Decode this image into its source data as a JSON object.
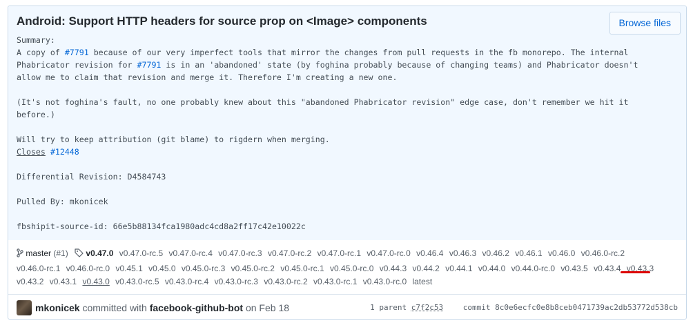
{
  "commit": {
    "title": "Android: Support HTTP headers for source prop on <Image> components",
    "browse_files_label": "Browse files",
    "description": [
      [
        {
          "t": "Summary:"
        }
      ],
      [
        {
          "t": "A copy of "
        },
        {
          "t": "#7791",
          "link": true
        },
        {
          "t": " because of our very imperfect tools that mirror the changes from pull requests in the fb monorepo. The internal"
        }
      ],
      [
        {
          "t": "Phabricator revision for "
        },
        {
          "t": "#7791",
          "link": true
        },
        {
          "t": " is in an 'abandoned' state (by foghina probably because of changing teams) and Phabricator doesn't"
        }
      ],
      [
        {
          "t": "allow me to claim that revision and merge it. Therefore I'm creating a new one."
        }
      ],
      [
        {
          "t": ""
        }
      ],
      [
        {
          "t": "(It's not foghina's fault, no one probably knew about this \"abandoned Phabricator revision\" edge case, don't remember we hit it"
        }
      ],
      [
        {
          "t": "before.)"
        }
      ],
      [
        {
          "t": ""
        }
      ],
      [
        {
          "t": "Will try to keep attribution (git blame) to rigdern when merging."
        }
      ],
      [
        {
          "t": "Closes",
          "underline": true
        },
        {
          "t": " "
        },
        {
          "t": "#12448",
          "link": true
        }
      ],
      [
        {
          "t": ""
        }
      ],
      [
        {
          "t": "Differential Revision: D4584743"
        }
      ],
      [
        {
          "t": ""
        }
      ],
      [
        {
          "t": "Pulled By: mkonicek"
        }
      ],
      [
        {
          "t": ""
        }
      ],
      [
        {
          "t": "fbshipit-source-id: 66e5b88134fca1980adc4cd8a2ff17c42e10022c"
        }
      ]
    ],
    "branch": {
      "name": "master",
      "pr": "(#1)"
    },
    "current_tag": "v0.47.0",
    "tags": [
      "v0.47.0-rc.5",
      "v0.47.0-rc.4",
      "v0.47.0-rc.3",
      "v0.47.0-rc.2",
      "v0.47.0-rc.1",
      "v0.47.0-rc.0",
      "v0.46.4",
      "v0.46.3",
      "v0.46.2",
      "v0.46.1",
      "v0.46.0",
      "v0.46.0-rc.2",
      "v0.46.0-rc.1",
      "v0.46.0-rc.0",
      "v0.45.1",
      "v0.45.0",
      "v0.45.0-rc.3",
      "v0.45.0-rc.2",
      "v0.45.0-rc.1",
      "v0.45.0-rc.0",
      "v0.44.3",
      "v0.44.2",
      "v0.44.1",
      "v0.44.0",
      "v0.44.0-rc.0",
      "v0.43.5",
      "v0.43.4",
      "v0.43.3",
      "v0.43.2",
      "v0.43.1",
      "v0.43.0",
      "v0.43.0-rc.5",
      "v0.43.0-rc.4",
      "v0.43.0-rc.3",
      "v0.43.0-rc.2",
      "v0.43.0-rc.1",
      "v0.43.0-rc.0",
      "latest"
    ],
    "highlighted_tag": "v0.43.0",
    "author": "mkonicek",
    "committed_with_text": "committed with",
    "committer": "facebook-github-bot",
    "date_text": "on Feb 18",
    "parent_label": "1 parent",
    "parent_sha": "c7f2c53",
    "commit_label": "commit",
    "commit_sha": "8c0e6ecfc0e8b8ceb0471739ac2db53772d538cb"
  },
  "colors": {
    "link": "#0366d6",
    "header_bg": "#f1f8ff",
    "border": "#c8d9ea",
    "annotation": "#dd0000"
  }
}
